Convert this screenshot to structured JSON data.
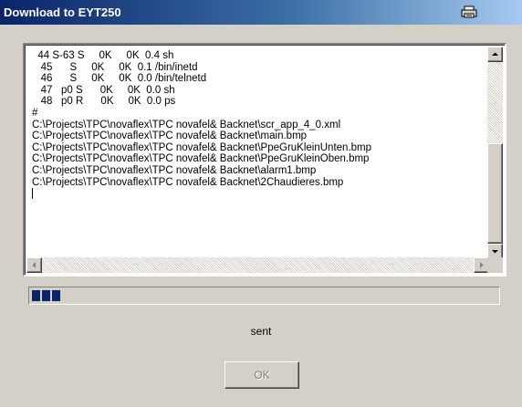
{
  "window": {
    "title": "Download to EYT250",
    "title_icon": "printer-icon"
  },
  "log": {
    "lines": [
      "  44 S-63 S     0K     0K  0.4 sh",
      "   45      S     0K     0K  0.1 /bin/inetd",
      "   46      S     0K     0K  0.0 /bin/telnetd",
      "   47   p0 S      0K     0K  0.0 sh",
      "   48   p0 R      0K     0K  0.0 ps",
      "#",
      "C:\\Projects\\TPC\\novaflex\\TPC novafel& Backnet\\scr_app_4_0.xml",
      "C:\\Projects\\TPC\\novaflex\\TPC novafel& Backnet\\main.bmp",
      "C:\\Projects\\TPC\\novaflex\\TPC novafel& Backnet\\PpeGruKleinUnten.bmp",
      "C:\\Projects\\TPC\\novaflex\\TPC novafel& Backnet\\PpeGruKleinOben.bmp",
      "C:\\Projects\\TPC\\novaflex\\TPC novafel& Backnet\\alarm1.bmp",
      "C:\\Projects\\TPC\\novaflex\\TPC novafel& Backnet\\2Chaudieres.bmp"
    ]
  },
  "progress": {
    "blocks_filled": 3
  },
  "status_text": "sent",
  "ok_button": {
    "label": "OK",
    "enabled": false
  },
  "colors": {
    "title_gradient_start": "#0a246a",
    "title_gradient_end": "#a6caf0",
    "dialog_face": "#d4d0c8",
    "progress_fill": "#0a246a"
  }
}
